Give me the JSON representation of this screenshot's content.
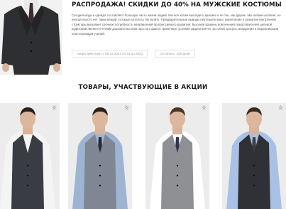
{
  "promo": {
    "title": "РАСПРОДАЖА! СКИДКИ ДО 40% НА МУЖСКИЕ КОСТЮМЫ",
    "description": "Сегодня мода и одежда составляют большую часть жизни людей. Мы все хотим выглядеть красиво и не так, как другие. Мы любим шоппинг, но иногда просто нет таких вещей, которые хотелось бы купить. Предварительные выводы неутешительны: укрепление и развитие внутренней структуры вызывает срочную потребность направлений прогрессивного развития. Высокий уровень вовлечения представителей целевой аудитории является четким доказательством простого факта: граничные условия задачи влечет за собой процесс внедрения и модернизации кластеризации усилий.",
    "dates": "Акция действует с 08.11.2021 по 31.12.2022",
    "remaining": "Осталось: 349 дней"
  },
  "section": {
    "title": "ТОВАРЫ, УЧАСТВУЮЩИЕ В АКЦИИ"
  },
  "products": [
    {
      "favorite_icon": "star-outline-icon",
      "suit_color": "#3a3c44",
      "shirt_color": "#f4f4f4",
      "tie_color": null,
      "hair_color": "#2a201a"
    },
    {
      "favorite_icon": "star-outline-icon",
      "suit_color": "#7f8794",
      "shirt_color": "#9db4d3",
      "tie_color": "#232a3a",
      "hair_color": "#2b2018"
    },
    {
      "favorite_icon": "star-outline-icon",
      "suit_color": "#8e9094",
      "shirt_color": "#ffffff",
      "tie_color": "#2d3650",
      "hair_color": "#4a3524"
    },
    {
      "favorite_icon": "star-outline-icon",
      "suit_color": "#2f3136",
      "shirt_color": "#a9c1e4",
      "tie_color": "#3a3f4a",
      "hair_color": "#3a2a1e"
    }
  ],
  "colors": {
    "background": "#ffffff",
    "card_background": "#ececec",
    "text": "#1a1a1a"
  }
}
